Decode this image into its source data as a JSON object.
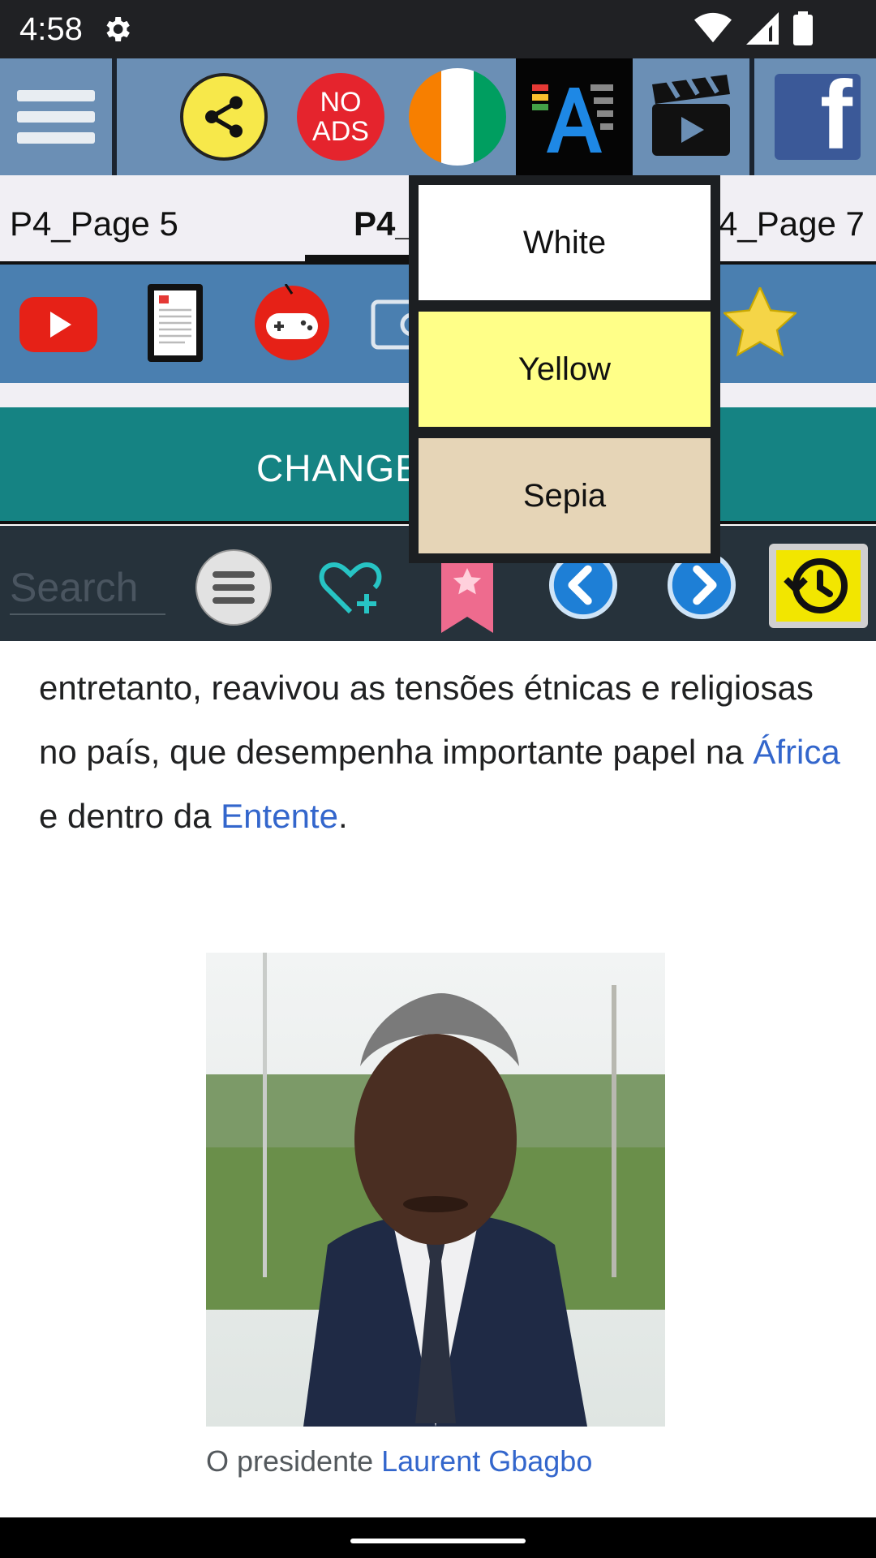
{
  "status_bar": {
    "time": "4:58"
  },
  "top_toolbar": {
    "no_ads_label_line1": "NO",
    "no_ads_label_line2": "ADS",
    "facebook_letter": "f"
  },
  "tabs": [
    {
      "label": "P4_Page 5"
    },
    {
      "label": "P4_Page 6"
    },
    {
      "label": "P4_Page 7"
    }
  ],
  "change_bar": {
    "label": "CHANGE"
  },
  "search": {
    "placeholder": "Search"
  },
  "article": {
    "text_1": "entretanto, reavivou as tensões étnicas e religiosas no país, que desempenha importante papel na ",
    "link_africa": "África",
    "text_2": " e dentro da ",
    "link_entente": "Entente",
    "text_3": ".",
    "caption_text": "O presidente ",
    "caption_link": "Laurent Gbagbo"
  },
  "popup": {
    "options": [
      {
        "label": "White",
        "color": "#ffffff"
      },
      {
        "label": "Yellow",
        "color": "#ffff88"
      },
      {
        "label": "Sepia",
        "color": "#e6d5b7"
      }
    ]
  },
  "colors": {
    "toolbar": "#6b8fb5",
    "icon_row": "#4a7fb0",
    "change_bar": "#158383",
    "search_bar": "#26323b",
    "link": "#3366cc"
  }
}
